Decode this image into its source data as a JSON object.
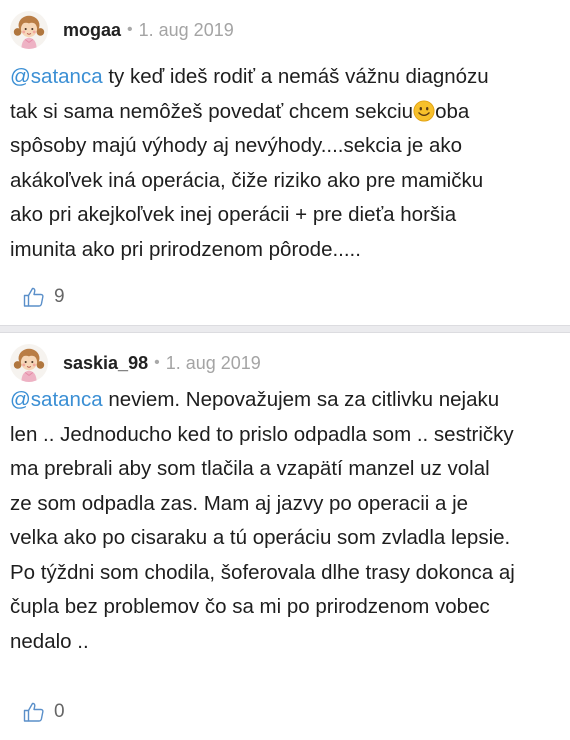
{
  "comments": [
    {
      "username": "mogaa",
      "separator": "•",
      "date": "1. aug 2019",
      "mention": "@satanca",
      "lines": [
        " ty keď ideš rodiť a nemáš vážnu diagnózu",
        "tak si sama nemôžeš povedať chcem sekciu",
        "oba",
        "spôsoby majú výhody aj nevýhody....sekcia je ako",
        "akákoľvek iná operácia, čiže riziko ako pre mamičku",
        "ako pri akejkoľvek inej operácii + pre dieťa horšia",
        "imunita ako pri prirodzenom pôrode....."
      ],
      "likes": "9"
    },
    {
      "username": "saskia_98",
      "separator": "•",
      "date": "1. aug 2019",
      "mention": "@satanca",
      "lines": [
        " neviem. Nepovažujem sa za citlivku nejaku",
        "len .. Jednoducho ked to prislo odpadla som .. sestričky",
        "ma prebrali aby som tlačila a vzapätí manzel uz volal",
        "ze som odpadla zas. Mam aj jazvy po operacii a je",
        "velka ako po cisaraku a tú operáciu som zvladla lepsie.",
        "Po týždni som chodila, šoferovala dlhe trasy dokonca aj",
        "čupla bez problemov čo sa mi po prirodzenom vobec",
        "nedalo .."
      ],
      "likes": "0"
    }
  ],
  "icons": {
    "avatar": "girl-avatar-icon",
    "like": "thumbs-up-icon",
    "emoji": "smiley-emoji-icon"
  },
  "colors": {
    "mention": "#3b8fd4",
    "meta": "#a4a4a4",
    "divider": "#ebebee"
  }
}
